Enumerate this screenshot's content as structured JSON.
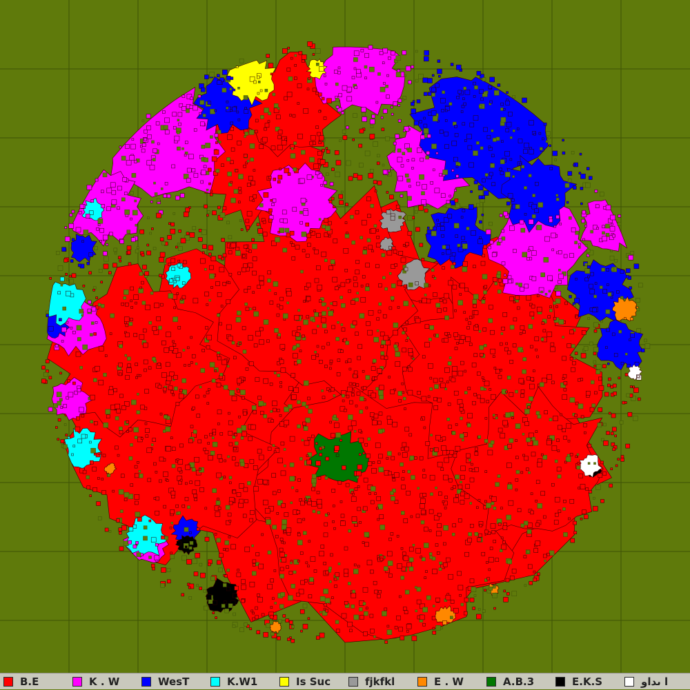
{
  "map": {
    "background_color": "#5f7a0b",
    "grid_color": "#3d5206",
    "grid_cell_count": 10,
    "circle_outline_color": "#3a4d05"
  },
  "legend": {
    "items": [
      {
        "label": "B.E",
        "color": "#ff0000"
      },
      {
        "label": "K . W",
        "color": "#ff00ff"
      },
      {
        "label": "WesT",
        "color": "#0000ff"
      },
      {
        "label": "K.W1",
        "color": "#00ffff"
      },
      {
        "label": "Is Suc",
        "color": "#ffff00"
      },
      {
        "label": "fjkfkl",
        "color": "#999999"
      },
      {
        "label": "E . W",
        "color": "#ff8800"
      },
      {
        "label": "A.B.3",
        "color": "#007700"
      },
      {
        "label": "E.K.S",
        "color": "#000000"
      },
      {
        "label": "ا ىداو",
        "color": "#ffffff"
      }
    ]
  }
}
